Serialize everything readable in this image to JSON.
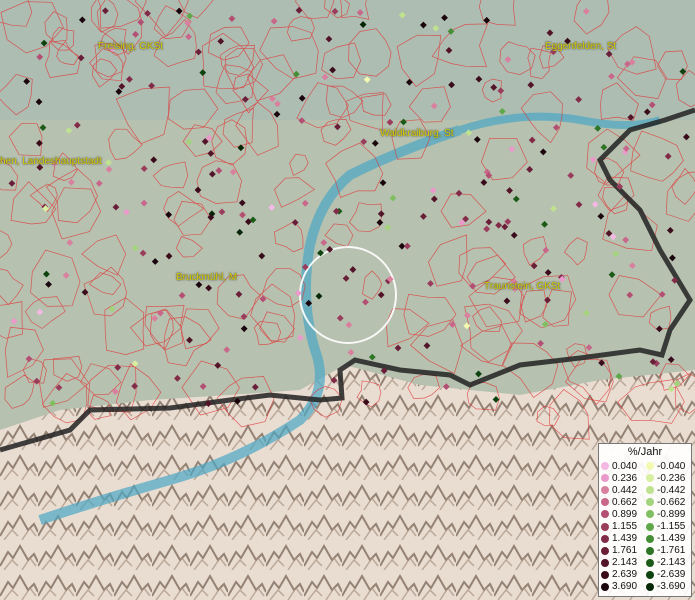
{
  "places": [
    {
      "name": "Freising, GKSt"
    },
    {
      "name": "Eggenfelden, St"
    },
    {
      "name": "Waldkraiburg, St"
    },
    {
      "name": "hen, Landeshauptstadt"
    },
    {
      "name": "Bruckmühl, M"
    },
    {
      "name": "Traunstein, GKSt"
    }
  ],
  "legend": {
    "title": "%/Jahr",
    "positive": [
      {
        "label": "0.040",
        "color": "#f3b8e4"
      },
      {
        "label": "0.236",
        "color": "#e99acb"
      },
      {
        "label": "0.442",
        "color": "#d9809f"
      },
      {
        "label": "0.662",
        "color": "#c8678a"
      },
      {
        "label": "0.899",
        "color": "#b24f73"
      },
      {
        "label": "1.155",
        "color": "#9a3c5c"
      },
      {
        "label": "1.439",
        "color": "#822b48"
      },
      {
        "label": "1.761",
        "color": "#6a1f38"
      },
      {
        "label": "2.143",
        "color": "#521428"
      },
      {
        "label": "2.639",
        "color": "#3a0c1b"
      },
      {
        "label": "3.690",
        "color": "#1a050c"
      }
    ],
    "negative": [
      {
        "label": "-0.040",
        "color": "#f4f9b0"
      },
      {
        "label": "-0.236",
        "color": "#d8efa0"
      },
      {
        "label": "-0.442",
        "color": "#bfe28e"
      },
      {
        "label": "-0.662",
        "color": "#a3d37c"
      },
      {
        "label": "-0.899",
        "color": "#7fbf61"
      },
      {
        "label": "-1.155",
        "color": "#5fa849"
      },
      {
        "label": "-1.439",
        "color": "#448f35"
      },
      {
        "label": "-1.761",
        "color": "#2f7526"
      },
      {
        "label": "-2.143",
        "color": "#1c5a18"
      },
      {
        "label": "-2.639",
        "color": "#0e420e"
      },
      {
        "label": "-3.690",
        "color": "#052605"
      }
    ]
  }
}
